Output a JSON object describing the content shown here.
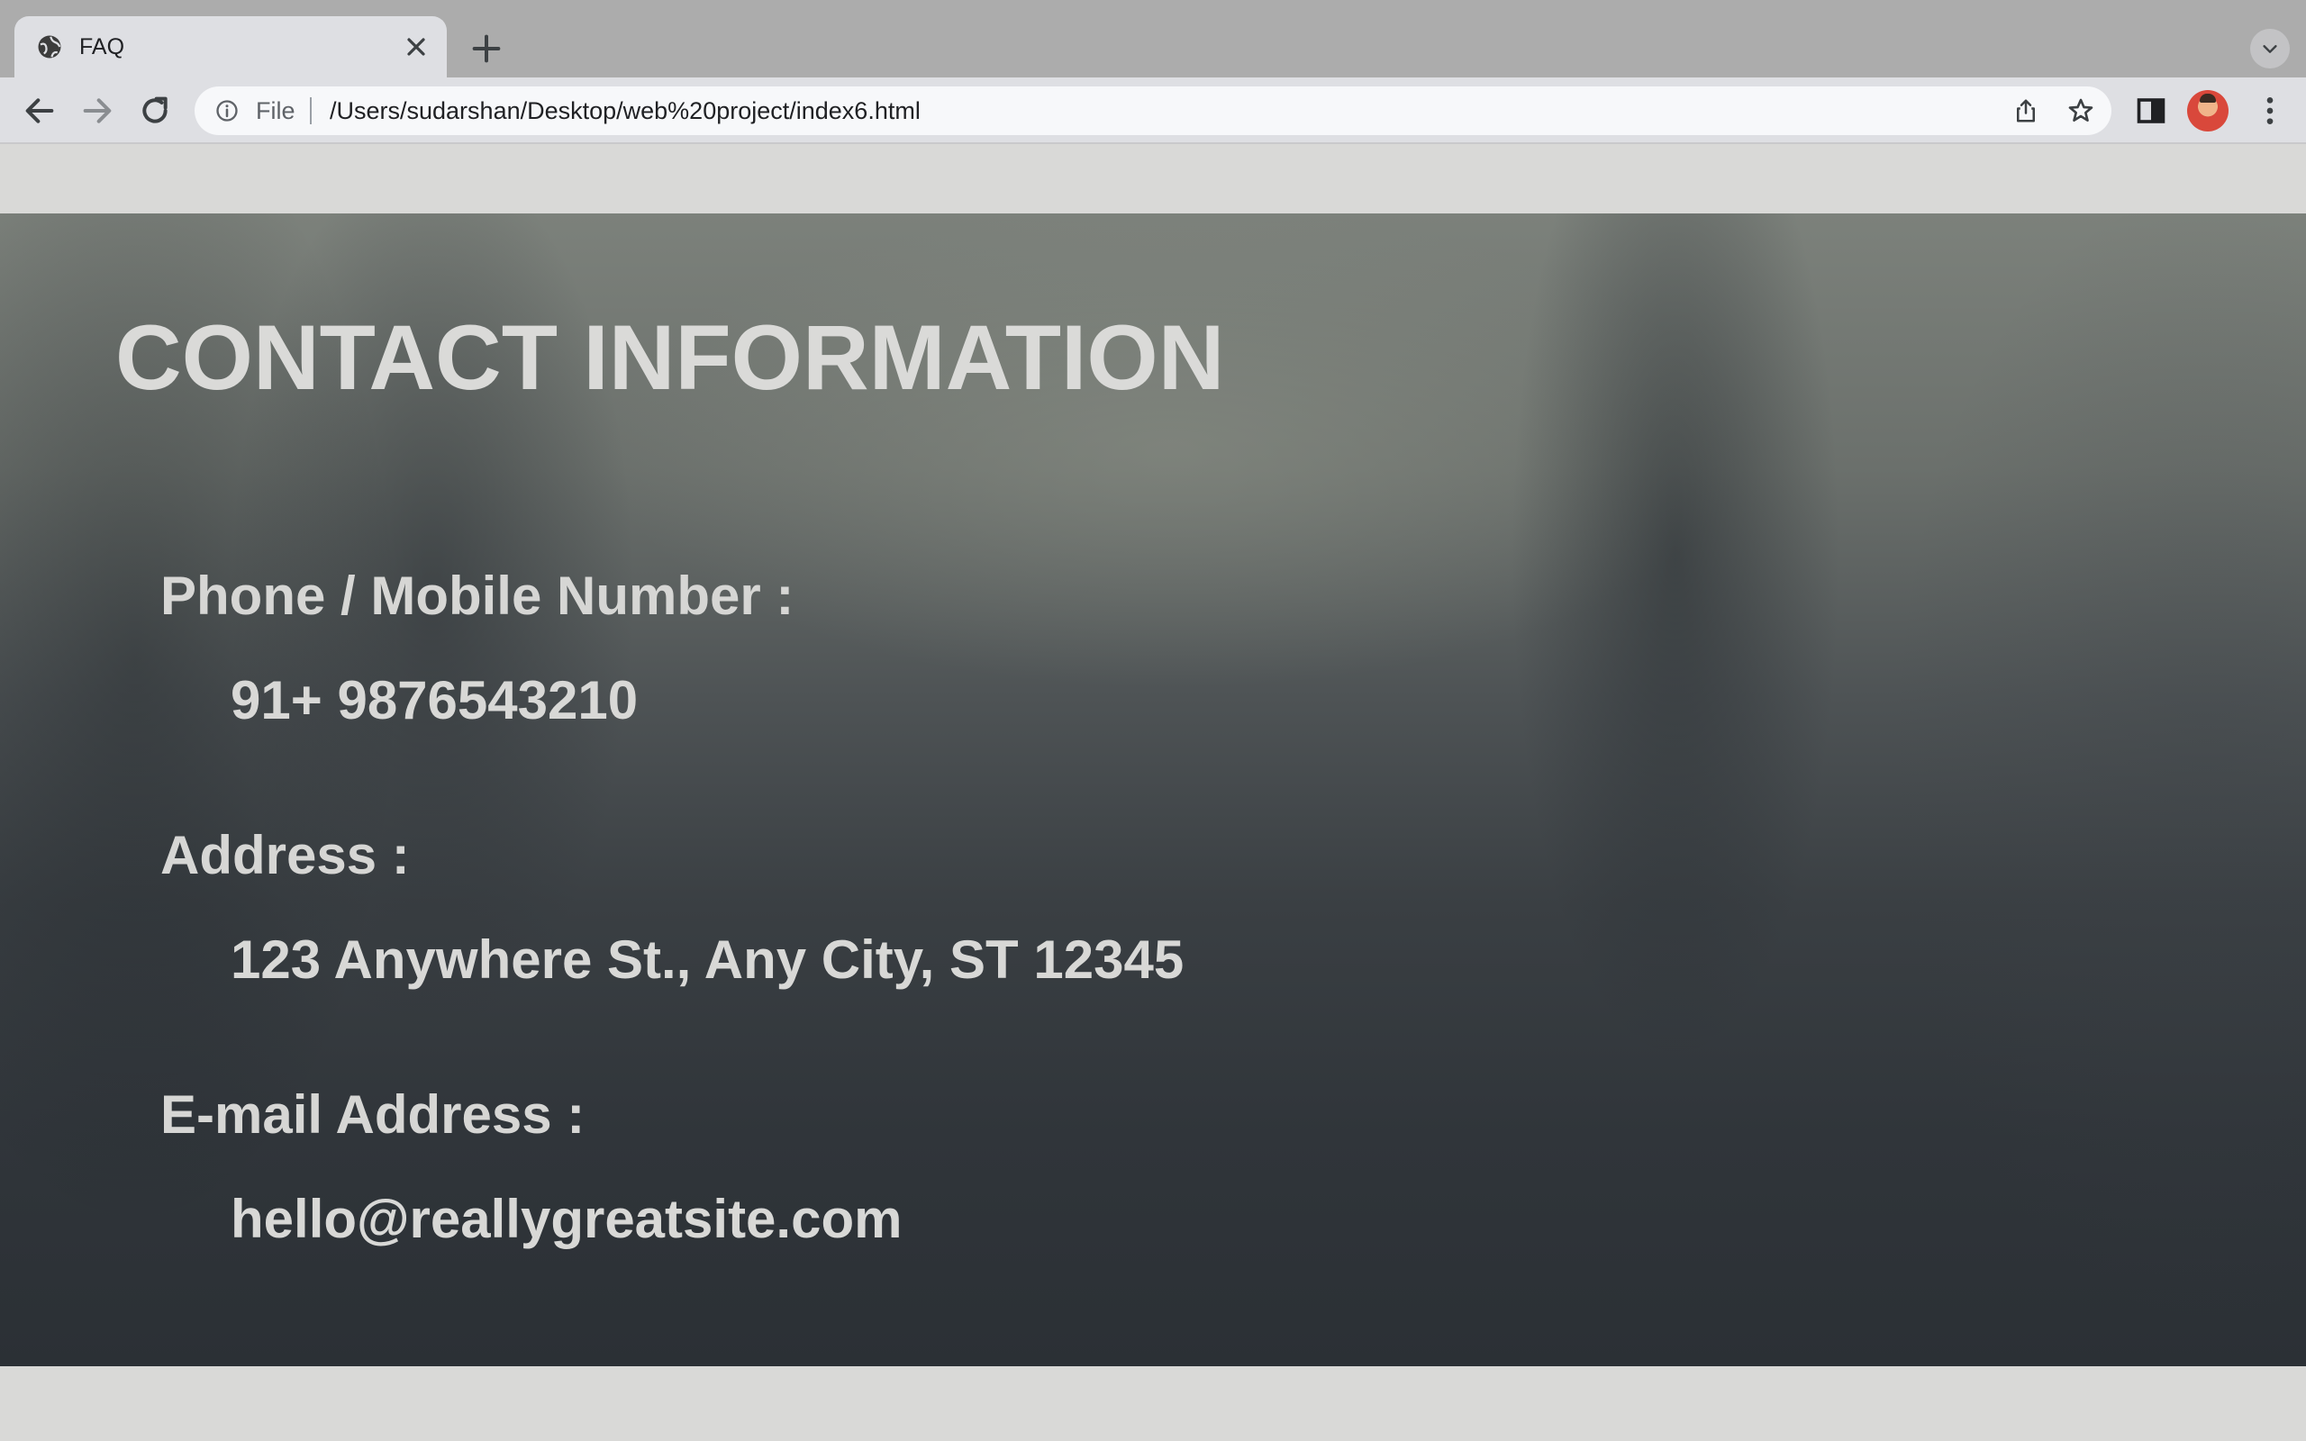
{
  "browser": {
    "tab": {
      "title": "FAQ"
    },
    "omnibox": {
      "scheme_label": "File",
      "url": "/Users/sudarshan/Desktop/web%20project/index6.html"
    }
  },
  "page": {
    "title": "CONTACT INFORMATION",
    "fields": [
      {
        "label": "Phone / Mobile Number :",
        "value": "91+ 9876543210"
      },
      {
        "label": "Address :",
        "value": "123 Anywhere St., Any City, ST 12345"
      },
      {
        "label": "E-mail Address :",
        "value": "hello@reallygreatsite.com"
      }
    ]
  },
  "colors": {
    "tabstrip": "#acacac",
    "toolbar": "#dedfe3",
    "page_background": "#d9d9d7",
    "text_light": "#dadad8"
  },
  "icons": [
    "globe-icon",
    "close-icon",
    "plus-icon",
    "chevron-down-icon",
    "back-arrow-icon",
    "forward-arrow-icon",
    "reload-icon",
    "info-icon",
    "share-icon",
    "star-icon",
    "side-panel-icon",
    "more-vert-icon"
  ]
}
